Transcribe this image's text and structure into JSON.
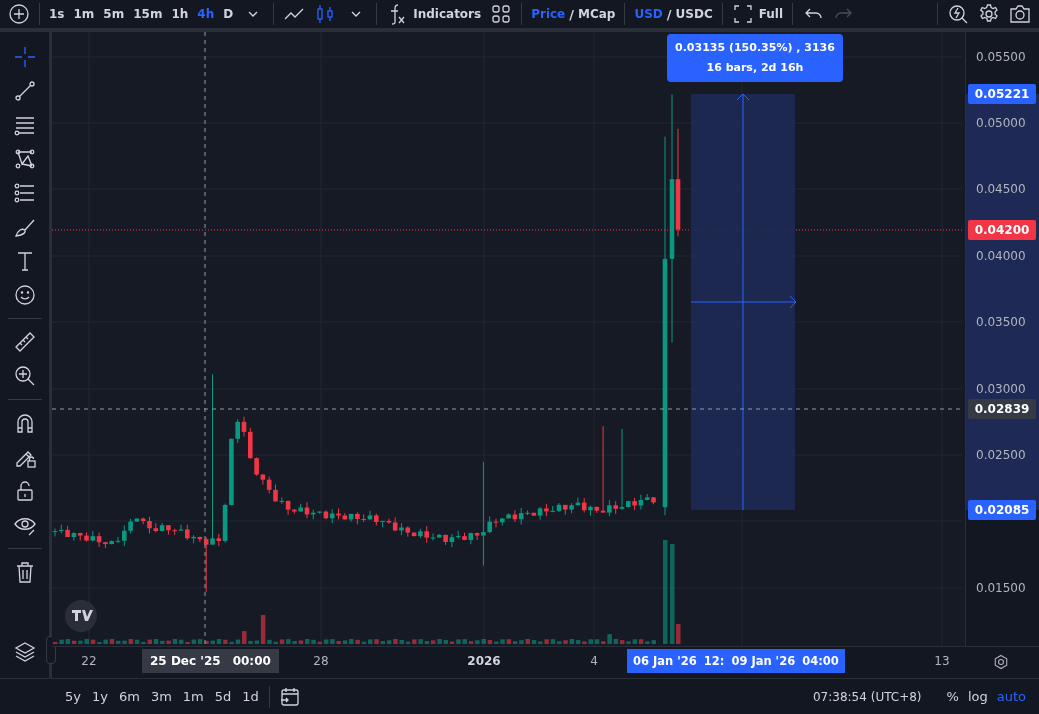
{
  "toolbar": {
    "intervals": [
      {
        "label": "1s",
        "selected": false
      },
      {
        "label": "1m",
        "selected": false
      },
      {
        "label": "5m",
        "selected": false
      },
      {
        "label": "15m",
        "selected": false
      },
      {
        "label": "1h",
        "selected": false
      },
      {
        "label": "4h",
        "selected": true
      },
      {
        "label": "D",
        "selected": false
      }
    ],
    "chart_styles": [
      {
        "kind": "line",
        "selected": false
      },
      {
        "kind": "candles",
        "selected": true
      }
    ],
    "indicators_button": "Indicators",
    "price_toggle": {
      "separator": "/",
      "options": [
        {
          "label": "Price",
          "selected": true
        },
        {
          "label": "MCap",
          "selected": false
        }
      ]
    },
    "currency_toggle": {
      "separator": "/",
      "options": [
        {
          "label": "USD",
          "selected": true
        },
        {
          "label": "USDC",
          "selected": false
        }
      ]
    },
    "full_button": "Full",
    "undo": {
      "disabled": false
    },
    "redo": {
      "disabled": true
    }
  },
  "tool_groups": [
    {
      "tools": [
        {
          "kind": "crosshair",
          "selected": true
        },
        {
          "kind": "trend_line",
          "selected": false
        },
        {
          "kind": "fib_lines",
          "selected": false
        },
        {
          "kind": "pattern",
          "selected": false
        },
        {
          "kind": "projection",
          "selected": false
        },
        {
          "kind": "brush",
          "selected": false
        },
        {
          "kind": "text",
          "selected": false
        },
        {
          "kind": "emoji",
          "selected": false
        }
      ]
    },
    {
      "tools": [
        {
          "kind": "ruler",
          "selected": false
        },
        {
          "kind": "zoom",
          "selected": false
        }
      ]
    },
    {
      "tools": [
        {
          "kind": "magnet",
          "selected": false
        },
        {
          "kind": "lock_pencil",
          "selected": false
        },
        {
          "kind": "lock",
          "selected": false
        },
        {
          "kind": "eye",
          "selected": false
        }
      ]
    },
    {
      "tools": [
        {
          "kind": "trash",
          "selected": false
        }
      ]
    }
  ],
  "measure_tooltip": {
    "line1": "0.03135 (150.35%) , 3136",
    "line2": "16 bars, 2d 16h"
  },
  "price_axis": {
    "ticks": [
      "0.05500",
      "0.05000",
      "0.04500",
      "0.04000",
      "0.03500",
      "0.03000",
      "0.02500",
      "0.01500"
    ],
    "markers": [
      {
        "kind": "measure",
        "text": "0.05221"
      },
      {
        "kind": "last_price",
        "text": "0.04200"
      },
      {
        "kind": "crosshair",
        "text": "0.02839"
      },
      {
        "kind": "measure",
        "text": "0.02085"
      }
    ]
  },
  "time_axis": {
    "labels": [
      {
        "kind": "day",
        "text": "22"
      },
      {
        "kind": "day",
        "text": "28"
      },
      {
        "kind": "year",
        "text": "2026"
      },
      {
        "kind": "day",
        "text": "4"
      },
      {
        "kind": "day",
        "text": "13"
      }
    ],
    "crosshair_label": {
      "date": "25 Dec '25",
      "time": "00:00"
    },
    "measure_range": [
      "06 Jan '26",
      "12:",
      "09 Jan '26",
      "04:00"
    ]
  },
  "bottom_bar": {
    "ranges": [
      "5y",
      "1y",
      "6m",
      "3m",
      "1m",
      "5d",
      "1d"
    ],
    "clock": "07:38:54 (UTC+8)",
    "scale_options": [
      {
        "label": "%",
        "selected": false
      },
      {
        "label": "log",
        "selected": false
      },
      {
        "label": "auto",
        "selected": true
      }
    ]
  }
}
